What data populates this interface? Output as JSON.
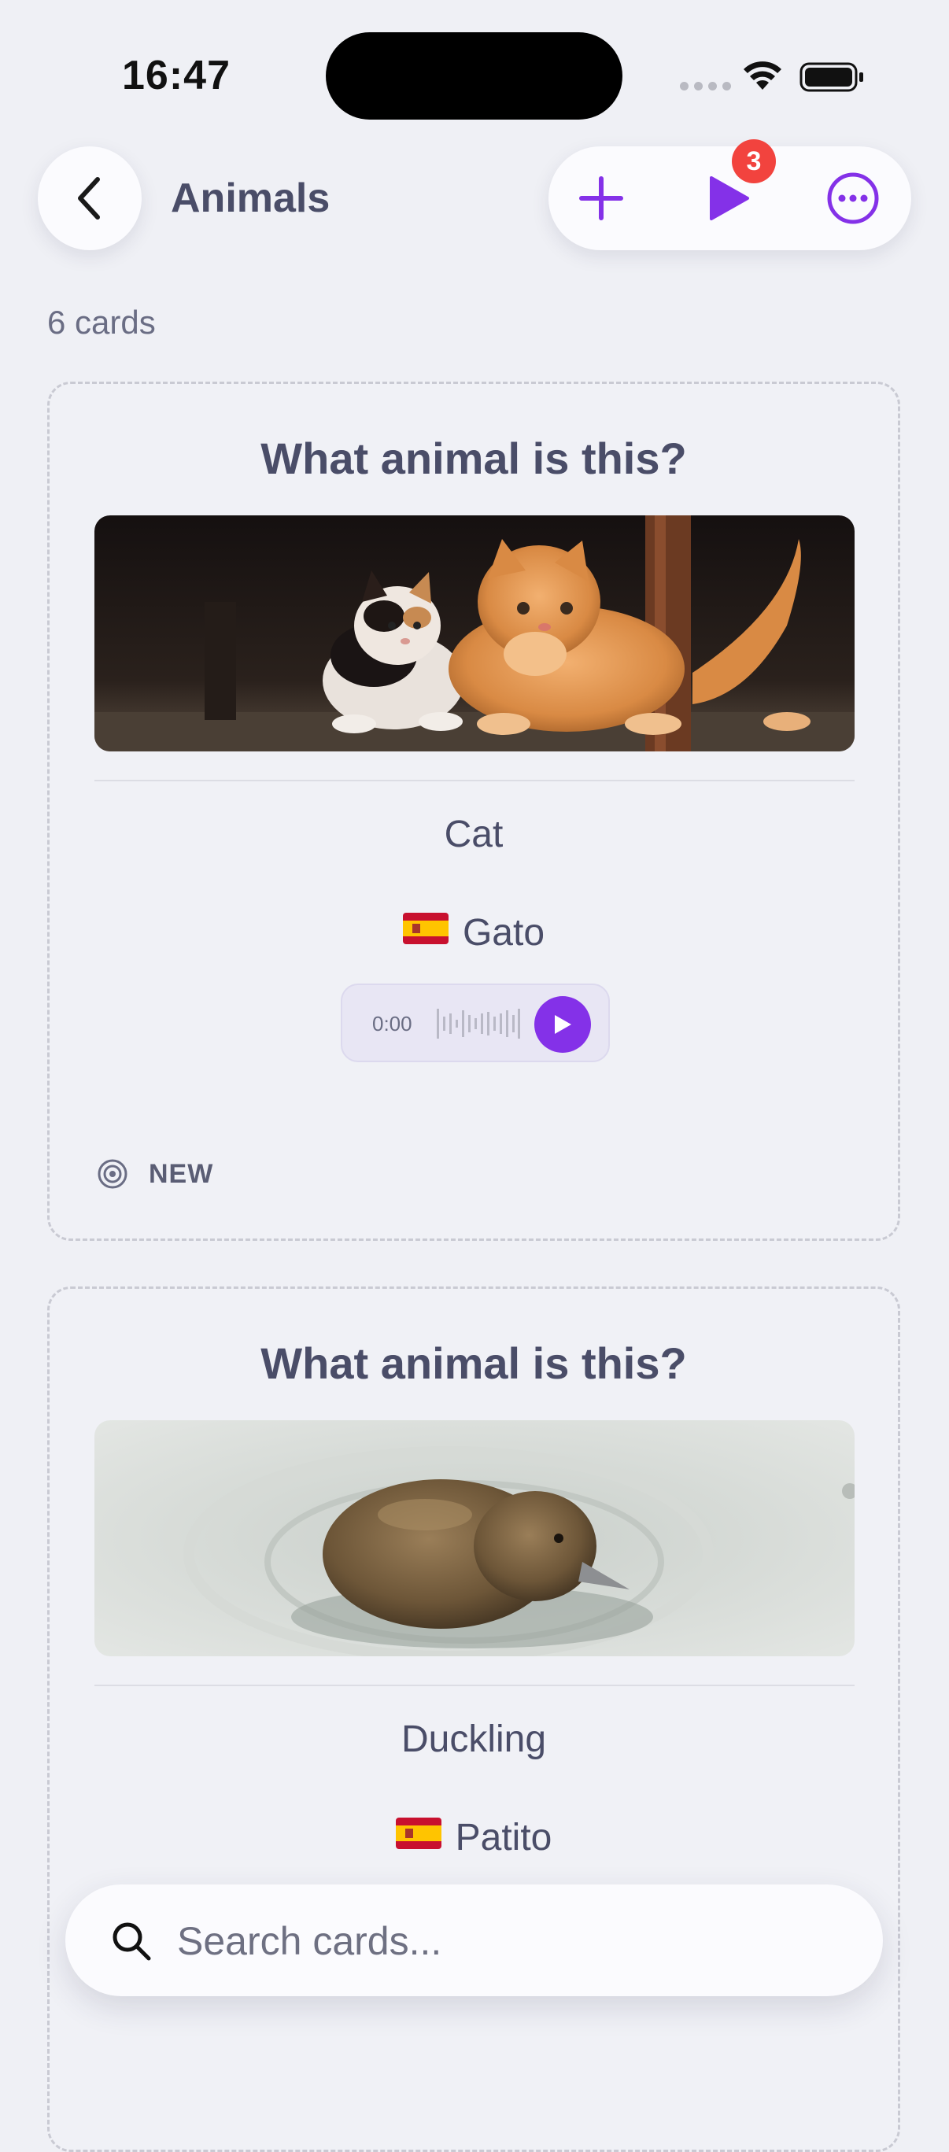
{
  "status_bar": {
    "time": "16:47"
  },
  "header": {
    "title": "Animals",
    "back_icon": "chevron-left-icon",
    "actions": [
      {
        "name": "add",
        "icon": "plus-icon"
      },
      {
        "name": "play",
        "icon": "play-icon",
        "badge": "3"
      },
      {
        "name": "more",
        "icon": "ellipsis-circle-icon"
      }
    ]
  },
  "deck": {
    "count_label": "6 cards"
  },
  "cards": [
    {
      "question": "What animal is this?",
      "image": "kittens-photo",
      "answer": "Cat",
      "flag": "🇪🇸",
      "translation": "Gato",
      "audio_time": "0:00",
      "status": "NEW"
    },
    {
      "question": "What animal is this?",
      "image": "duckling-photo",
      "answer": "Duckling",
      "flag": "🇪🇸",
      "translation": "Patito"
    }
  ],
  "search": {
    "placeholder": "Search cards..."
  },
  "colors": {
    "accent": "#8431e8",
    "badge": "#f2433e",
    "background": "#eff0f5",
    "text": "#4a4d68"
  }
}
